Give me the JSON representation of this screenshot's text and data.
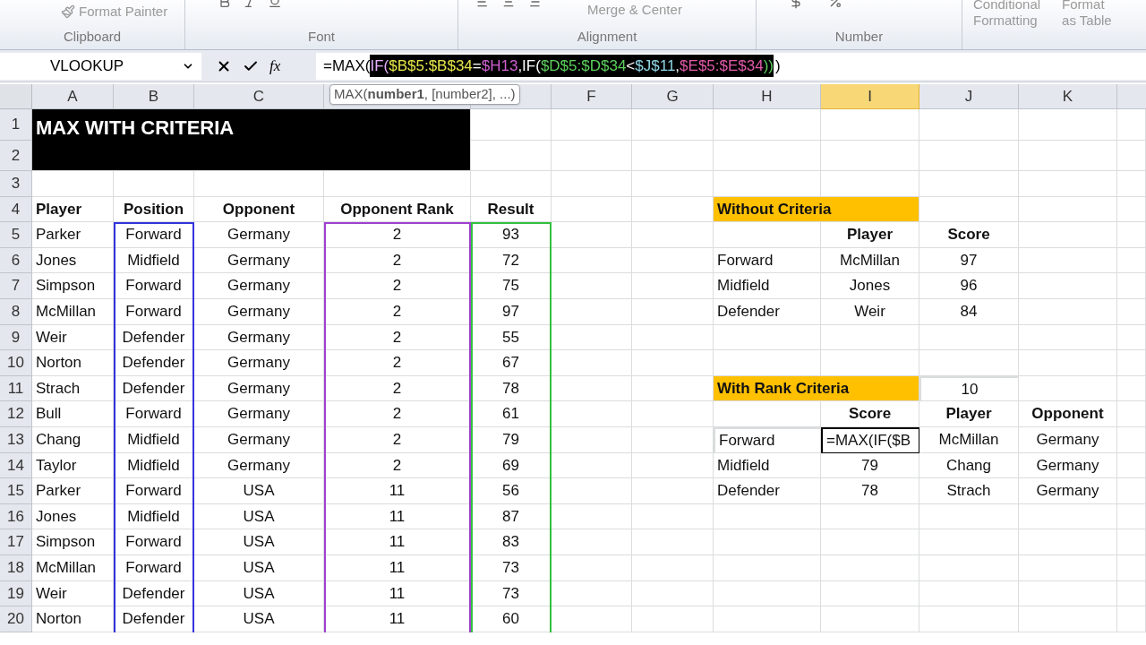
{
  "ribbon": {
    "clipboard_button": "Format Painter",
    "merge_button": "Merge & Center",
    "styles_buttons": [
      {
        "top": "Conditional",
        "bottom": "Formatting"
      },
      {
        "top": "Format",
        "bottom": "as Table"
      }
    ],
    "groups": [
      "Clipboard",
      "Font",
      "Alignment",
      "Number"
    ]
  },
  "formula_bar": {
    "name_box": "VLOOKUP",
    "function_button": "fx",
    "prefix": "=MAX(",
    "selection": [
      {
        "text": "IF(",
        "kind": "paren"
      },
      {
        "text": "$B$5:$B$34",
        "kind": "ref"
      },
      {
        "text": "=",
        "kind": "op"
      },
      {
        "text": "$H13",
        "kind": "ref"
      },
      {
        "text": ",IF(",
        "kind": "op"
      },
      {
        "text": "$D$5:$D$34",
        "kind": "ref"
      },
      {
        "text": "<",
        "kind": "op"
      },
      {
        "text": "$J$11",
        "kind": "ref"
      },
      {
        "text": ",",
        "kind": "op"
      },
      {
        "text": "$E$5:$E$34",
        "kind": "ref"
      },
      {
        "text": "))",
        "kind": "paren"
      }
    ],
    "suffix": ")"
  },
  "tooltip": "MAX(**number1**, [number2], ...)",
  "columns": [
    {
      "label": "A",
      "selected": false
    },
    {
      "label": "B",
      "selected": false
    },
    {
      "label": "C",
      "selected": false
    },
    {
      "label": "F",
      "selected": false
    },
    {
      "label": "G",
      "selected": false
    },
    {
      "label": "H",
      "selected": false
    },
    {
      "label": "I",
      "selected": true
    },
    {
      "label": "J",
      "selected": false
    },
    {
      "label": "K",
      "selected": false
    }
  ],
  "row_numbers": [
    "1",
    "2",
    "3",
    "4",
    "5",
    "6",
    "7",
    "8",
    "9",
    "10",
    "11",
    "12",
    "13",
    "14",
    "15",
    "16",
    "17",
    "18",
    "19",
    "20"
  ],
  "title": "MAX WITH CRITERIA",
  "main_table": {
    "columns": [
      "Player",
      "Position",
      "Opponent",
      "Opponent Rank",
      "Result"
    ],
    "rows": [
      [
        "Parker",
        "Forward",
        "Germany",
        "2",
        "93"
      ],
      [
        "Jones",
        "Midfield",
        "Germany",
        "2",
        "72"
      ],
      [
        "Simpson",
        "Forward",
        "Germany",
        "2",
        "75"
      ],
      [
        "McMillan",
        "Forward",
        "Germany",
        "2",
        "97"
      ],
      [
        "Weir",
        "Defender",
        "Germany",
        "2",
        "55"
      ],
      [
        "Norton",
        "Defender",
        "Germany",
        "2",
        "67"
      ],
      [
        "Strach",
        "Defender",
        "Germany",
        "2",
        "78"
      ],
      [
        "Bull",
        "Forward",
        "Germany",
        "2",
        "61"
      ],
      [
        "Chang",
        "Midfield",
        "Germany",
        "2",
        "79"
      ],
      [
        "Taylor",
        "Midfield",
        "Germany",
        "2",
        "69"
      ],
      [
        "Parker",
        "Forward",
        "USA",
        "11",
        "56"
      ],
      [
        "Jones",
        "Midfield",
        "USA",
        "11",
        "87"
      ],
      [
        "Simpson",
        "Forward",
        "USA",
        "11",
        "83"
      ],
      [
        "McMillan",
        "Forward",
        "USA",
        "11",
        "73"
      ],
      [
        "Weir",
        "Defender",
        "USA",
        "11",
        "73"
      ],
      [
        "Norton",
        "Defender",
        "USA",
        "11",
        "60"
      ]
    ]
  },
  "without_criteria": {
    "title": "Without Criteria",
    "columns": [
      "",
      "Player",
      "Score"
    ],
    "rows": [
      [
        "Forward",
        "McMillan",
        "97"
      ],
      [
        "Midfield",
        "Jones",
        "96"
      ],
      [
        "Defender",
        "Weir",
        "84"
      ]
    ]
  },
  "with_rank_criteria": {
    "title": "With Rank Criteria",
    "rank": "10",
    "columns": [
      "",
      "Score",
      "Player",
      "Opponent"
    ],
    "rows": [
      {
        "cells": [
          "Forward",
          "=MAX(IF($B",
          "McMillan",
          "Germany"
        ],
        "editing": true
      },
      {
        "cells": [
          "Midfield",
          "79",
          "Chang",
          "Germany"
        ],
        "editing": false
      },
      {
        "cells": [
          "Defender",
          "78",
          "Strach",
          "Germany"
        ],
        "editing": false
      }
    ]
  }
}
